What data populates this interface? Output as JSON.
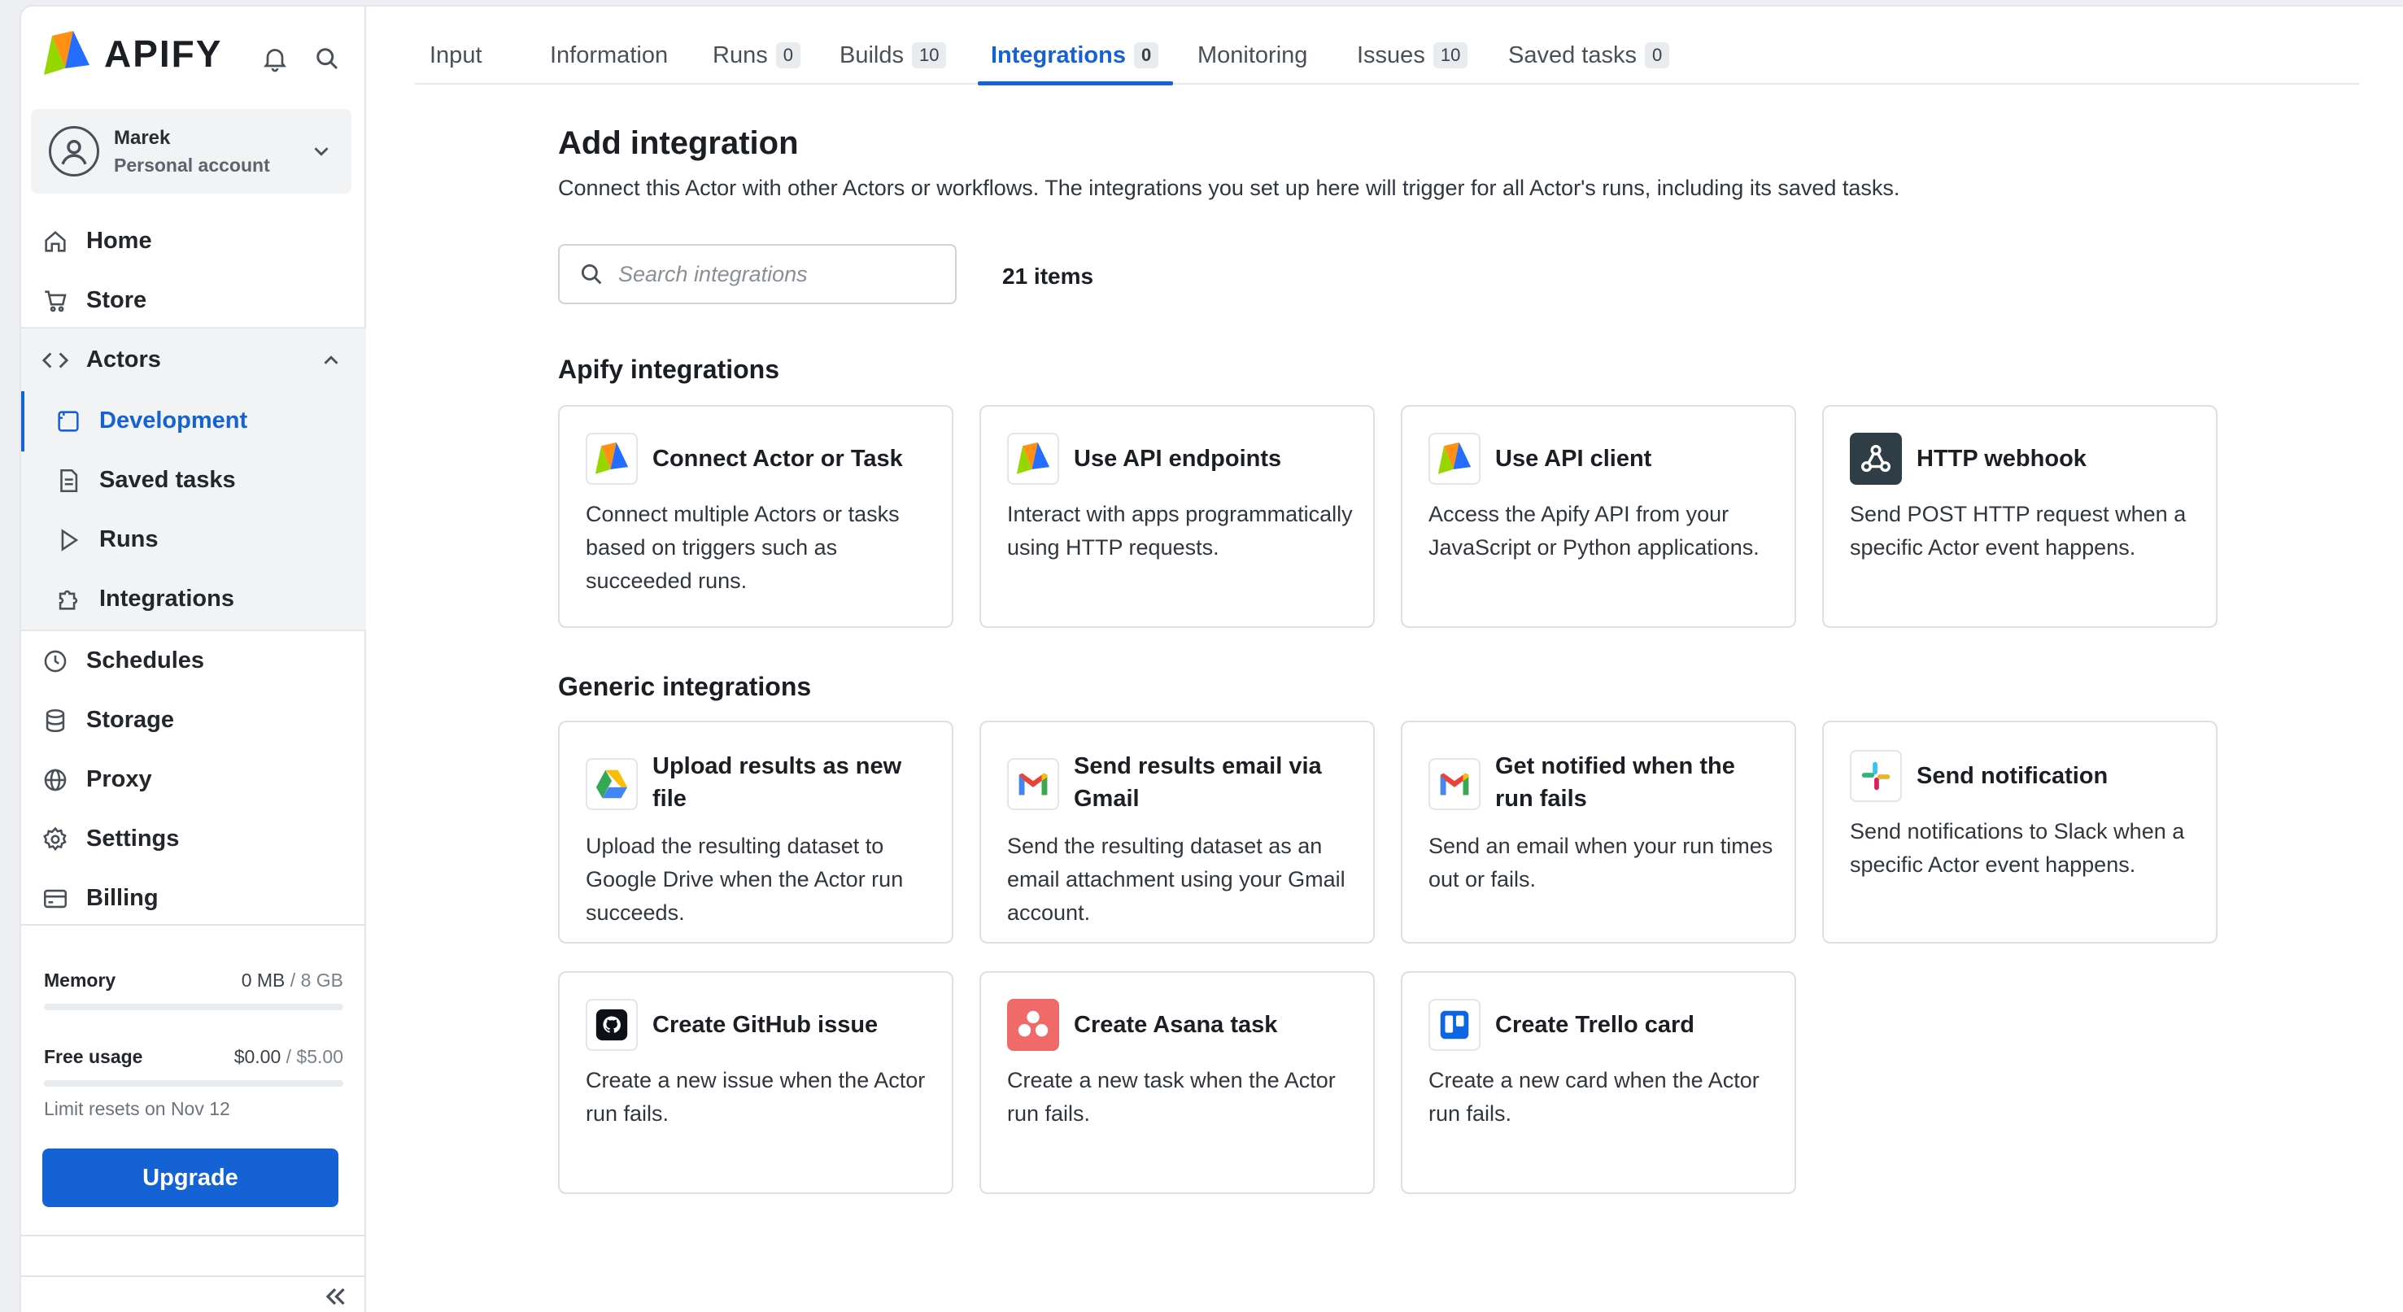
{
  "brand": {
    "name": "APIFY"
  },
  "account": {
    "name": "Marek",
    "type": "Personal account"
  },
  "nav": {
    "home": "Home",
    "store": "Store",
    "actors": "Actors",
    "development": "Development",
    "saved_tasks": "Saved tasks",
    "runs": "Runs",
    "integrations": "Integrations",
    "schedules": "Schedules",
    "storage": "Storage",
    "proxy": "Proxy",
    "settings": "Settings",
    "billing": "Billing"
  },
  "usage": {
    "memory_label": "Memory",
    "memory_used": "0 MB",
    "memory_total": "/ 8 GB",
    "memory_fraction": 0,
    "free_label": "Free usage",
    "free_used": "$0.00",
    "free_total": "/ $5.00",
    "free_fraction": 0,
    "limit_text": "Limit resets on Nov 12",
    "upgrade_label": "Upgrade"
  },
  "tabs": [
    {
      "label": "Input",
      "count": null
    },
    {
      "label": "Information",
      "count": null
    },
    {
      "label": "Runs",
      "count": "0"
    },
    {
      "label": "Builds",
      "count": "10"
    },
    {
      "label": "Integrations",
      "count": "0",
      "active": true
    },
    {
      "label": "Monitoring",
      "count": null
    },
    {
      "label": "Issues",
      "count": "10"
    },
    {
      "label": "Saved tasks",
      "count": "0"
    }
  ],
  "page": {
    "title": "Add integration",
    "description": "Connect this Actor with other Actors or workflows. The integrations you set up here will trigger for all Actor's runs, including its saved tasks.",
    "search_placeholder": "Search integrations",
    "items_count": "21 items"
  },
  "sections": {
    "apify": "Apify integrations",
    "generic": "Generic integrations"
  },
  "apify_cards": [
    {
      "title": "Connect Actor or Task",
      "body": "Connect multiple Actors or tasks based on triggers such as succeeded runs.",
      "icon": "apify-logo-icon"
    },
    {
      "title": "Use API endpoints",
      "body": "Interact with apps programmatically using HTTP requests.",
      "icon": "apify-logo-icon"
    },
    {
      "title": "Use API client",
      "body": "Access the Apify API from your JavaScript or Python applications.",
      "icon": "apify-logo-icon"
    },
    {
      "title": "HTTP webhook",
      "body": "Send POST HTTP request when a specific Actor event happens.",
      "icon": "webhook-icon"
    }
  ],
  "generic_cards": [
    {
      "title": "Upload results as new file",
      "body": "Upload the resulting dataset to Google Drive when the Actor run succeeds.",
      "icon": "google-drive-icon"
    },
    {
      "title": "Send results email via Gmail",
      "body": "Send the resulting dataset as an email attachment using your Gmail account.",
      "icon": "gmail-icon"
    },
    {
      "title": "Get notified when the run fails",
      "body": "Send an email when your run times out or fails.",
      "icon": "gmail-icon"
    },
    {
      "title": "Send notification",
      "body": "Send notifications to Slack when a specific Actor event happens.",
      "icon": "slack-icon"
    },
    {
      "title": "Create GitHub issue",
      "body": "Create a new issue when the Actor run fails.",
      "icon": "github-icon"
    },
    {
      "title": "Create Asana task",
      "body": "Create a new task when the Actor run fails.",
      "icon": "asana-icon"
    },
    {
      "title": "Create Trello card",
      "body": "Create a new card when the Actor run fails.",
      "icon": "trello-icon"
    }
  ],
  "colors": {
    "accent": "#1562d4",
    "sidebar_group_bg": "#f1f3f5",
    "card_border": "#dcdfe3"
  }
}
